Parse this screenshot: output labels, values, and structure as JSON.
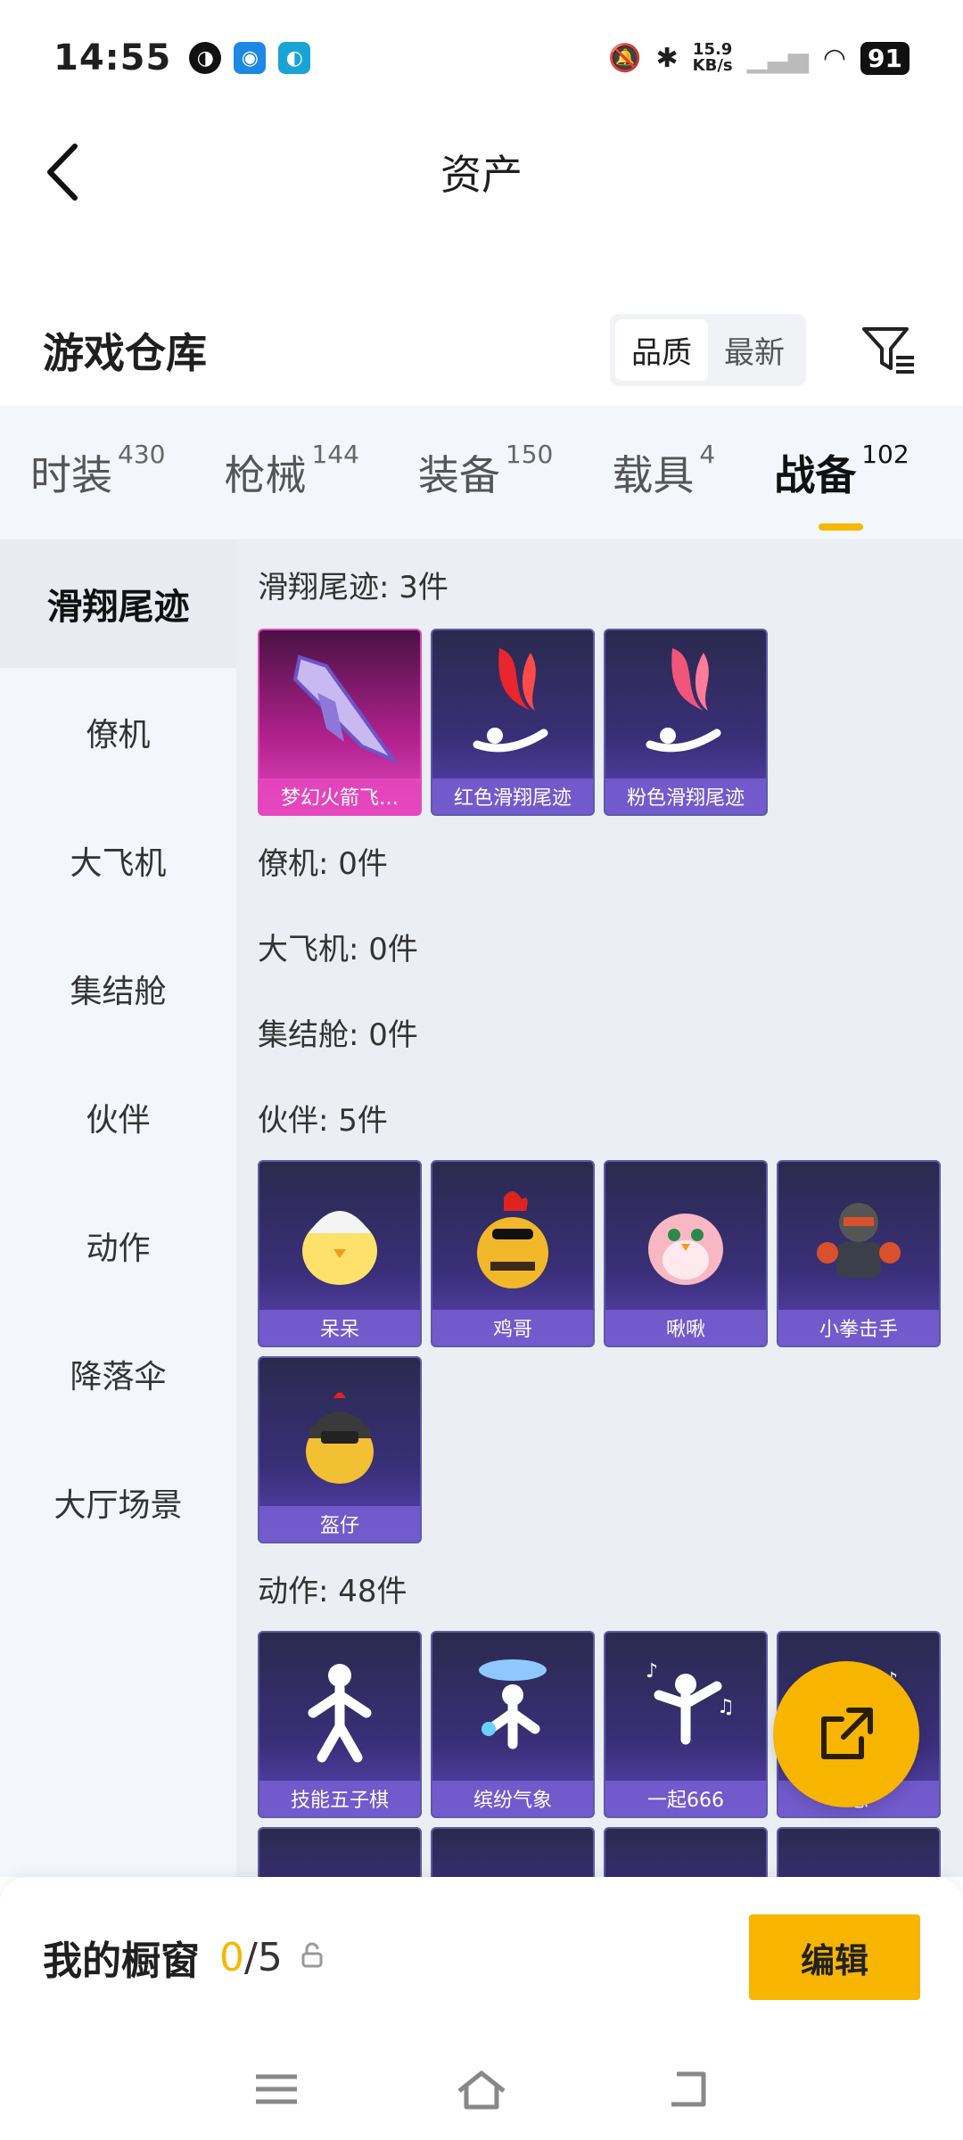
{
  "status_bar": {
    "time": "14:55",
    "net_speed_value": "15.9",
    "net_speed_unit": "KB/s",
    "battery": "91"
  },
  "header": {
    "title": "资产"
  },
  "warehouse": {
    "title": "游戏仓库",
    "sort_options": [
      "品质",
      "最新"
    ],
    "active_sort": "品质"
  },
  "tabs": [
    {
      "label": "时装",
      "count": "430"
    },
    {
      "label": "枪械",
      "count": "144"
    },
    {
      "label": "装备",
      "count": "150"
    },
    {
      "label": "载具",
      "count": "4"
    },
    {
      "label": "战备",
      "count": "102"
    }
  ],
  "active_tab": "战备",
  "sidebar": {
    "items": [
      "滑翔尾迹",
      "僚机",
      "大飞机",
      "集结舱",
      "伙伴",
      "动作",
      "降落伞",
      "大厅场景"
    ],
    "active": "滑翔尾迹"
  },
  "sections": {
    "trail": {
      "title": "滑翔尾迹: 3件",
      "items": [
        "梦幻火箭飞…",
        "红色滑翔尾迹",
        "粉色滑翔尾迹"
      ]
    },
    "wingman": {
      "title": "僚机: 0件"
    },
    "plane": {
      "title": "大飞机: 0件"
    },
    "pod": {
      "title": "集结舱: 0件"
    },
    "partner": {
      "title": "伙伴: 5件",
      "items": [
        "呆呆",
        "鸡哥",
        "啾啾",
        "小拳击手",
        "盔仔"
      ]
    },
    "emote": {
      "title": "动作: 48件",
      "items": [
        "技能五子棋",
        "缤纷气象",
        "一起666",
        "思"
      ]
    }
  },
  "showcase": {
    "title": "我的橱窗",
    "current": "0",
    "total": "/5",
    "edit_label": "编辑"
  }
}
